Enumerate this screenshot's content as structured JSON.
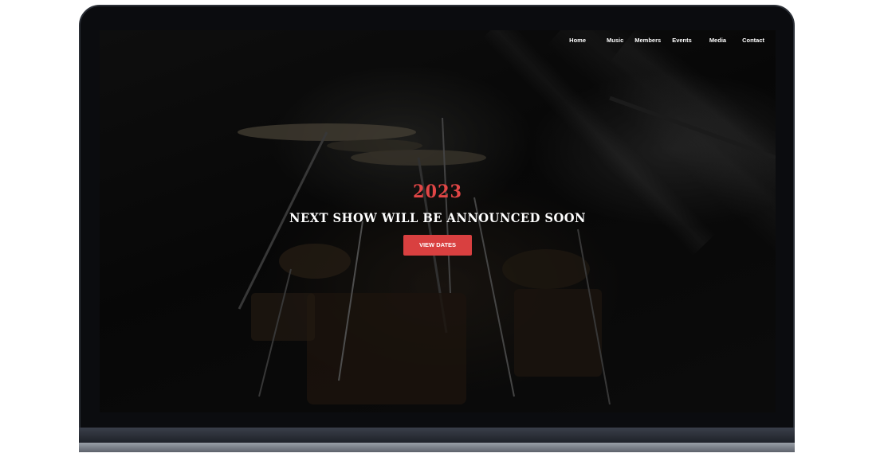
{
  "nav": {
    "items": [
      {
        "label": "Home"
      },
      {
        "label": "Music"
      },
      {
        "label": "Members"
      },
      {
        "label": "Events"
      },
      {
        "label": "Media"
      },
      {
        "label": "Contact"
      }
    ]
  },
  "hero": {
    "year": "2023",
    "title": "NEXT SHOW WILL BE ANNOUNCED SOON",
    "button_label": "VIEW DATES"
  },
  "colors": {
    "accent": "#d94040",
    "year": "#e04646",
    "background": "#0e0e0e"
  },
  "icons": {
    "hero_image": "drum-kit-photo"
  }
}
